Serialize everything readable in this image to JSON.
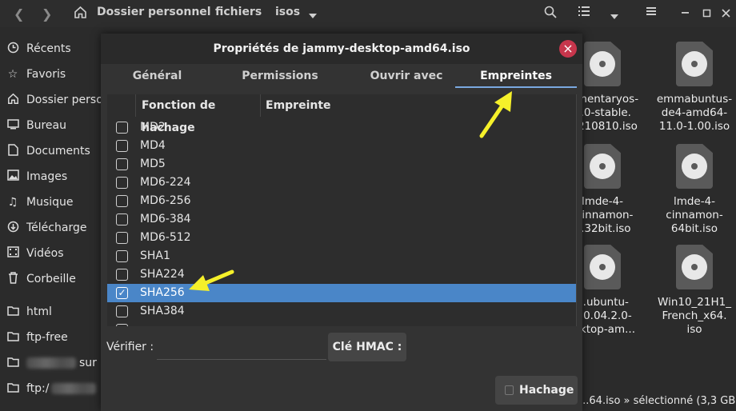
{
  "header": {
    "breadcrumbs": [
      "Dossier personnel",
      "fichiers",
      "isos"
    ],
    "dropdown_icon": "chevron-down-icon"
  },
  "sidebar": {
    "items": [
      {
        "label": "Récents",
        "icon": "clock-icon"
      },
      {
        "label": "Favoris",
        "icon": "star-icon"
      },
      {
        "label": "Dossier perso",
        "icon": "home-icon"
      },
      {
        "label": "Bureau",
        "icon": "desktop-icon"
      },
      {
        "label": "Documents",
        "icon": "document-icon"
      },
      {
        "label": "Images",
        "icon": "image-icon"
      },
      {
        "label": "Musique",
        "icon": "music-icon"
      },
      {
        "label": "Télécharge",
        "icon": "download-icon"
      },
      {
        "label": "Vidéos",
        "icon": "video-icon"
      },
      {
        "label": "Corbeille",
        "icon": "trash-icon"
      },
      {
        "label": "html",
        "icon": "folder-icon"
      },
      {
        "label": "ftp-free",
        "icon": "folder-icon"
      },
      {
        "label": "sur",
        "icon": "folder-icon"
      },
      {
        "label": "ftp:/",
        "icon": "folder-icon"
      }
    ]
  },
  "files": [
    {
      "name": "...mentaryos-\n...0-stable.\n...210810.iso"
    },
    {
      "name": "emmabuntus-\nde4-amd64-\n11.0-1.00.iso"
    },
    {
      "name": "lmde-4-\n...innamon-\n...32bit.iso"
    },
    {
      "name": "lmde-4-\ncinnamon-\n64bit.iso"
    },
    {
      "name": "...ubuntu-\n...0.04.2.0-\n...ktop-am..."
    },
    {
      "name": "Win10_21H1_\nFrench_x64.\niso"
    }
  ],
  "status": "...64.iso » sélectionné (3,3 GB)",
  "dialog": {
    "title": "Propriétés de jammy-desktop-amd64.iso",
    "tabs": [
      {
        "label": "Général"
      },
      {
        "label": "Permissions"
      },
      {
        "label": "Ouvrir avec"
      },
      {
        "label": "Empreintes"
      }
    ],
    "active_tab": "Empreintes",
    "columns": [
      "Fonction de hachage",
      "Empreinte"
    ],
    "hash_functions": [
      {
        "name": "MD2",
        "checked": false
      },
      {
        "name": "MD4",
        "checked": false
      },
      {
        "name": "MD5",
        "checked": false
      },
      {
        "name": "MD6-224",
        "checked": false
      },
      {
        "name": "MD6-256",
        "checked": false
      },
      {
        "name": "MD6-384",
        "checked": false
      },
      {
        "name": "MD6-512",
        "checked": false
      },
      {
        "name": "SHA1",
        "checked": false
      },
      {
        "name": "SHA224",
        "checked": false
      },
      {
        "name": "SHA256",
        "checked": true
      },
      {
        "name": "SHA384",
        "checked": false
      }
    ],
    "verify_label": "Vérifier :",
    "verify_value": "",
    "hmac_label": "Clé HMAC :",
    "hash_button_label": "Hachage"
  },
  "colors": {
    "selection": "#4a86c8",
    "close": "#c7364c",
    "annotation_arrow": "#f5f02a"
  }
}
